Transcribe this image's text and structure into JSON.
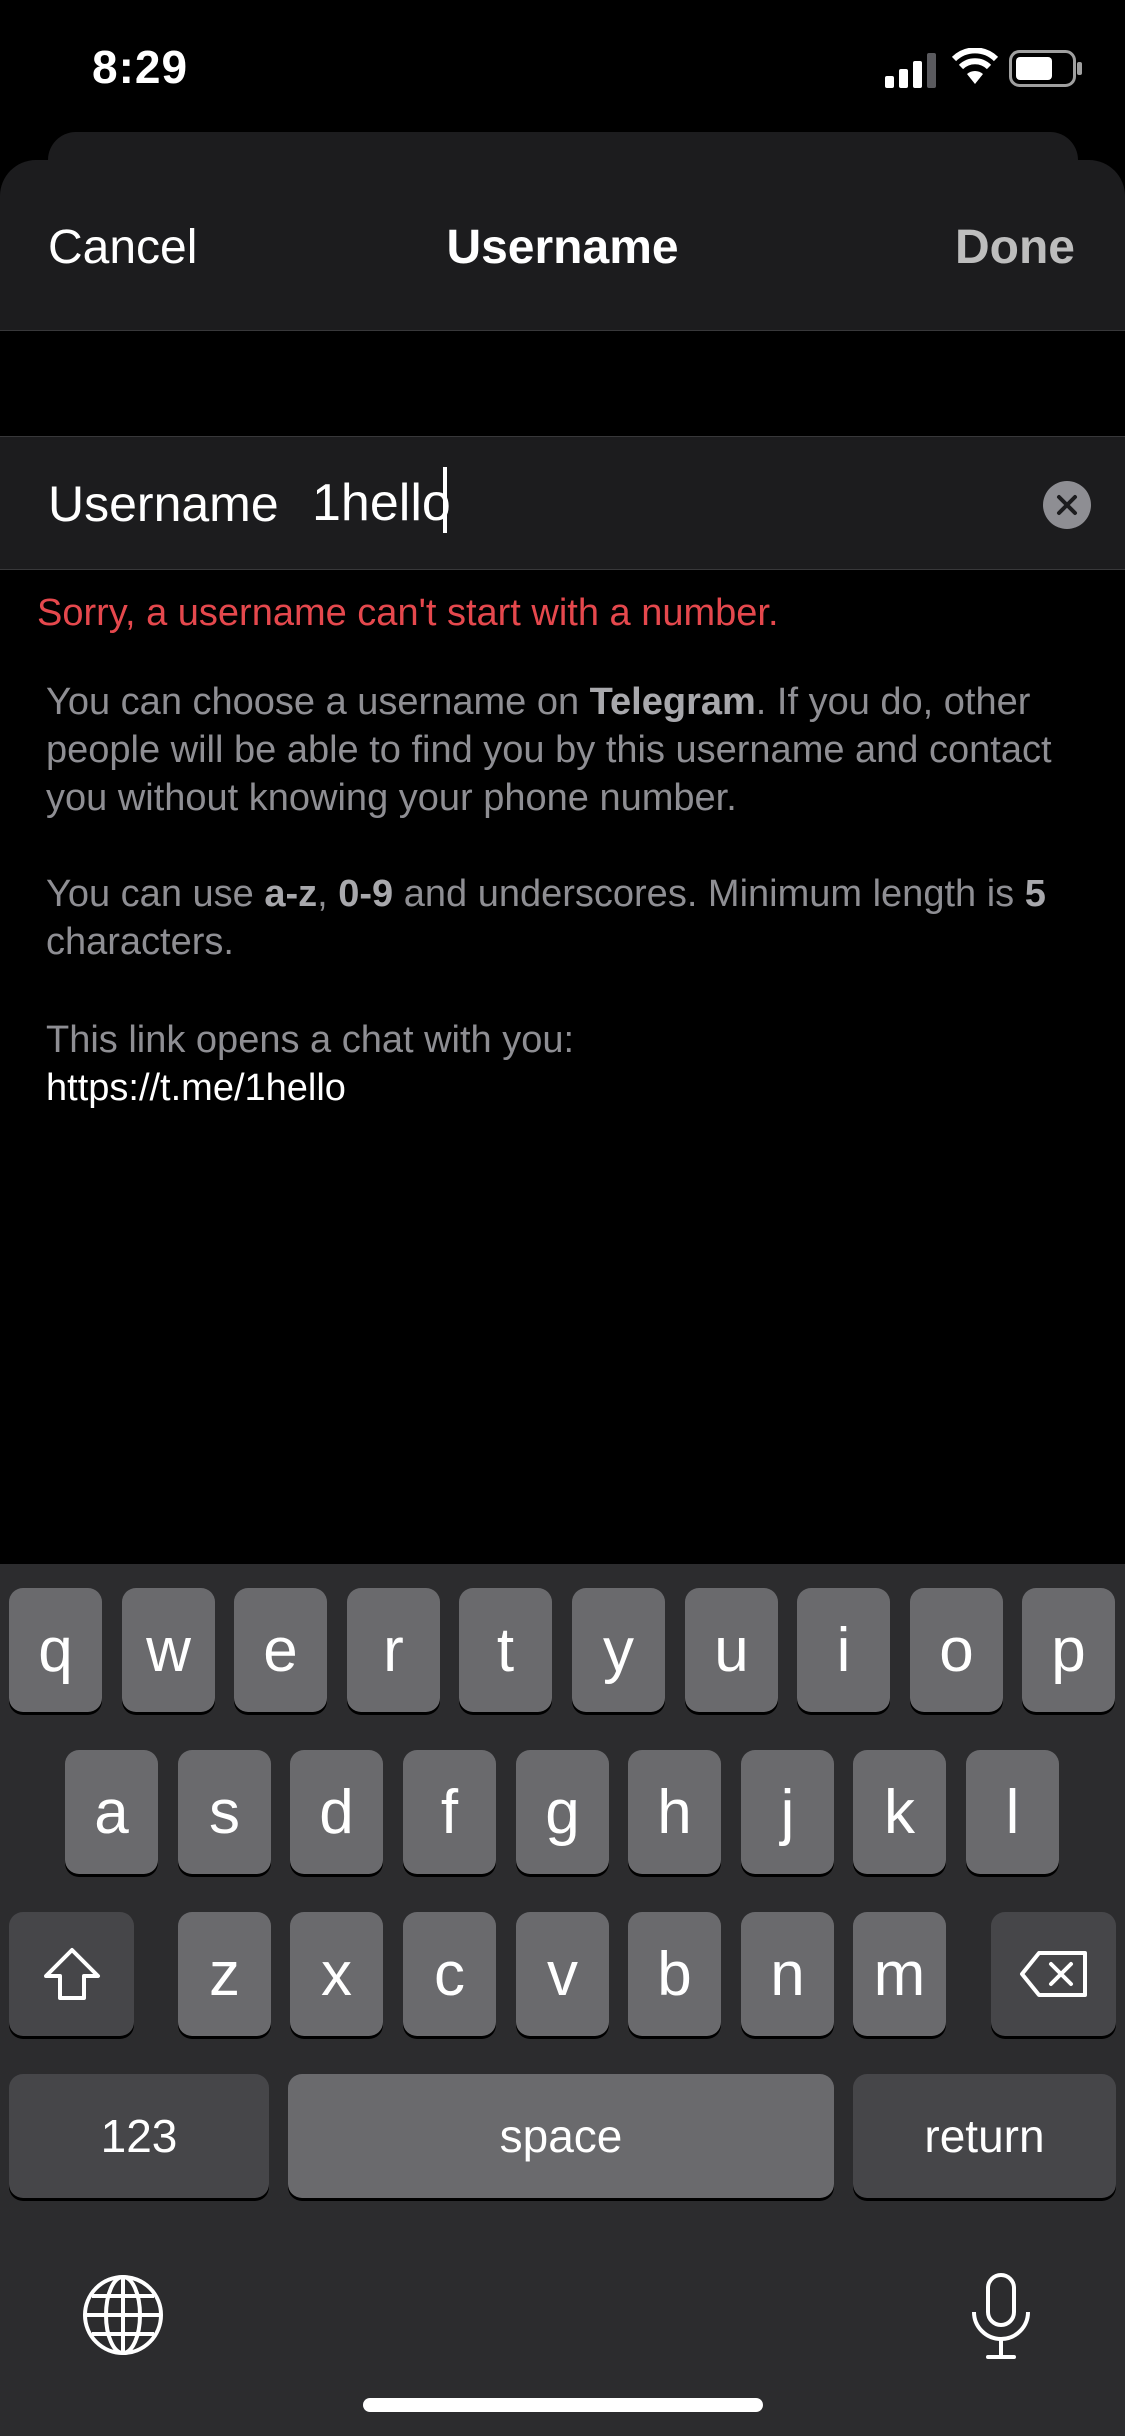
{
  "status_bar": {
    "time": "8:29"
  },
  "nav": {
    "cancel": "Cancel",
    "title": "Username",
    "done": "Done"
  },
  "field": {
    "label": "Username",
    "value": "1hello"
  },
  "error": "Sorry, a username can't start with a number.",
  "info1": {
    "a": "You can choose a username on ",
    "brand": "Telegram",
    "b": ". If you do, other people will be able to find you by this username and contact you without knowing your phone number."
  },
  "info2": {
    "a": "You can use ",
    "az": "a-z",
    "c": ", ",
    "nums": "0-9",
    "d": " and underscores. Minimum length is ",
    "min": "5",
    "e": " characters."
  },
  "info3": {
    "text": "This link opens a chat with you:",
    "link": "https://t.me/1hello"
  },
  "keyboard": {
    "row1": [
      "q",
      "w",
      "e",
      "r",
      "t",
      "y",
      "u",
      "i",
      "o",
      "p"
    ],
    "row2": [
      "a",
      "s",
      "d",
      "f",
      "g",
      "h",
      "j",
      "k",
      "l"
    ],
    "row3": [
      "z",
      "x",
      "c",
      "v",
      "b",
      "n",
      "m"
    ],
    "numbers": "123",
    "space": "space",
    "return": "return"
  },
  "icons": [
    "signal-icon",
    "wifi-icon",
    "battery-icon",
    "clear-icon",
    "shift-icon",
    "delete-icon",
    "globe-icon",
    "microphone-icon"
  ],
  "colors": {
    "error": "#e5484d",
    "background": "#000000",
    "bar": "#1c1c1e",
    "key": "#6a6a6d",
    "key_dark": "#464649"
  }
}
